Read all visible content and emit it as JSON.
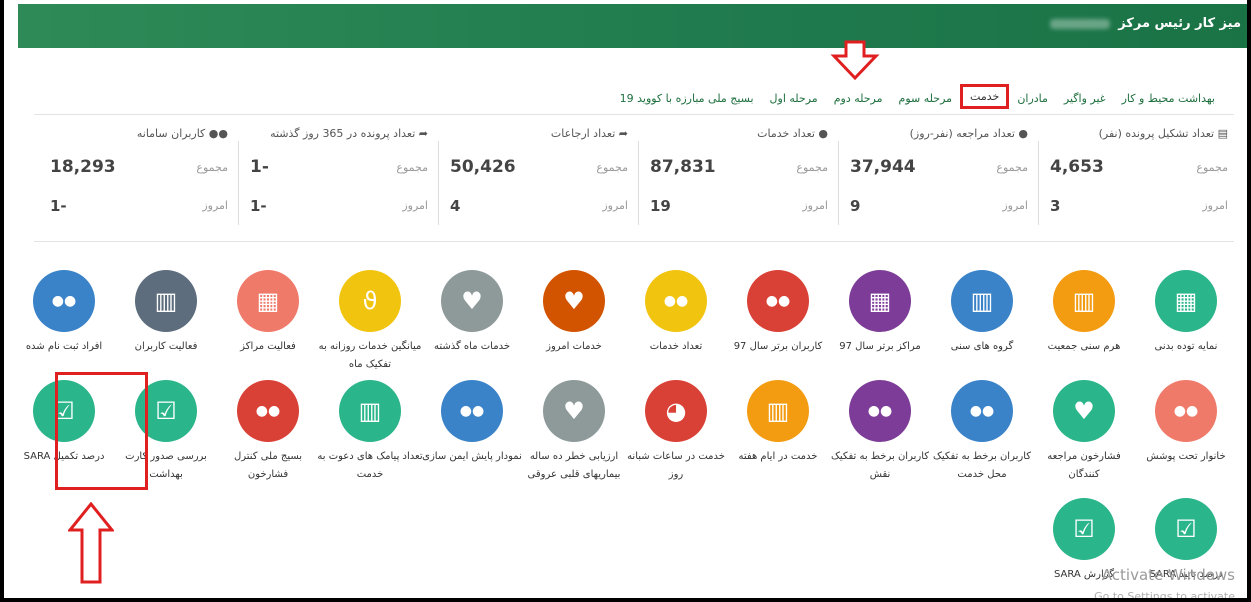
{
  "header": {
    "title": "میز کار رئیس مرکز"
  },
  "tabs": [
    {
      "label": "بسیج ملی مبارزه با کووید 19"
    },
    {
      "label": "مرحله اول"
    },
    {
      "label": "مرحله دوم"
    },
    {
      "label": "مرحله سوم"
    },
    {
      "label": "خدمت"
    },
    {
      "label": "مادران"
    },
    {
      "label": "غیر واگیر"
    },
    {
      "label": "بهداشت محیط و کار"
    }
  ],
  "stats": [
    {
      "title": "تعداد تشکیل پرونده (نفر)",
      "icon": "file-icon",
      "total_label": "مجموع",
      "total": "4,653",
      "today_label": "امروز",
      "today": "3"
    },
    {
      "title": "تعداد مراجعه (نفر-روز)",
      "icon": "user-icon",
      "total_label": "مجموع",
      "total": "37,944",
      "today_label": "امروز",
      "today": "9"
    },
    {
      "title": "تعداد خدمات",
      "icon": "user-md-icon",
      "total_label": "مجموع",
      "total": "87,831",
      "today_label": "امروز",
      "today": "19"
    },
    {
      "title": "تعداد ارجاعات",
      "icon": "share-icon",
      "total_label": "مجموع",
      "total": "50,426",
      "today_label": "امروز",
      "today": "4"
    },
    {
      "title": "تعداد پرونده در 365 روز گذشته",
      "icon": "share-icon",
      "total_label": "مجموع",
      "total": "1-",
      "today_label": "امروز",
      "today": "1-"
    },
    {
      "title": "کاربران سامانه",
      "icon": "users-icon",
      "total_label": "مجموع",
      "total": "18,293",
      "today_label": "امروز",
      "today": "1-"
    }
  ],
  "tiles_row1": [
    {
      "label": "نمایه توده بدنی",
      "color": "#2bb58a",
      "icon": "building-icon"
    },
    {
      "label": "هرم سنی جمعیت",
      "color": "#f39c12",
      "icon": "bar-chart-icon"
    },
    {
      "label": "گروه های سنی",
      "color": "#3a83c9",
      "icon": "bar-chart-icon"
    },
    {
      "label": "مراکز برتر سال 97",
      "color": "#7d3c98",
      "icon": "building-icon"
    },
    {
      "label": "کاربران برتر سال 97",
      "color": "#d94136",
      "icon": "users-icon"
    },
    {
      "label": "تعداد خدمات",
      "color": "#f1c40f",
      "icon": "users-icon"
    },
    {
      "label": "خدمات امروز",
      "color": "#d35400",
      "icon": "heartbeat-icon"
    },
    {
      "label": "خدمات ماه گذشته",
      "color": "#8e9a9a",
      "icon": "heartbeat-icon"
    },
    {
      "label": "میانگین خدمات روزانه به تفکیک ماه",
      "color": "#f1c40f",
      "icon": "stethoscope-icon"
    },
    {
      "label": "فعالیت مراکز",
      "color": "#f07a6a",
      "icon": "building-icon"
    },
    {
      "label": "فعالیت کاربران",
      "color": "#5d6d7e",
      "icon": "bar-chart-icon"
    },
    {
      "label": "افراد ثبت نام شده",
      "color": "#3a83c9",
      "icon": "users-icon"
    }
  ],
  "tiles_row2": [
    {
      "label": "خانوار تحت پوشش",
      "color": "#f07a6a",
      "icon": "users-icon"
    },
    {
      "label": "فشارخون مراجعه کنندگان",
      "color": "#2bb58a",
      "icon": "heartbeat-icon"
    },
    {
      "label": "کاربران برخط به تفکیک محل خدمت",
      "color": "#3a83c9",
      "icon": "users-icon"
    },
    {
      "label": "کاربران برخط به تفکیک نقش",
      "color": "#7d3c98",
      "icon": "users-icon"
    },
    {
      "label": "خدمت در ایام هفته",
      "color": "#f39c12",
      "icon": "bar-chart-icon"
    },
    {
      "label": "خدمت در ساعات شبانه روز",
      "color": "#d94136",
      "icon": "pie-chart-icon"
    },
    {
      "label": "ارزیابی خطر ده ساله بیماریهای قلبی عروقی",
      "color": "#8e9a9a",
      "icon": "heartbeat-icon"
    },
    {
      "label": "نمودار پایش ایمن سازی",
      "color": "#3a83c9",
      "icon": "users-icon"
    },
    {
      "label": "تعداد پیامک های دعوت به خدمت",
      "color": "#2bb58a",
      "icon": "bar-chart-icon"
    },
    {
      "label": "بسیج ملی کنترل فشارخون",
      "color": "#d94136",
      "icon": "users-icon"
    },
    {
      "label": "بررسی صدور کارت بهداشت",
      "color": "#2bb58a",
      "icon": "check-square-icon"
    },
    {
      "label": "درصد تکمیل SARA",
      "color": "#2bb58a",
      "icon": "check-icon"
    }
  ],
  "tiles_row3": [
    {
      "label": "درصد تایید SARA",
      "color": "#2bb58a",
      "icon": "check-icon"
    },
    {
      "label": "گزارش SARA",
      "color": "#2bb58a",
      "icon": "check-icon"
    }
  ],
  "watermark": {
    "line1": "Activate Windows",
    "line2": "Go to Settings to activate"
  }
}
